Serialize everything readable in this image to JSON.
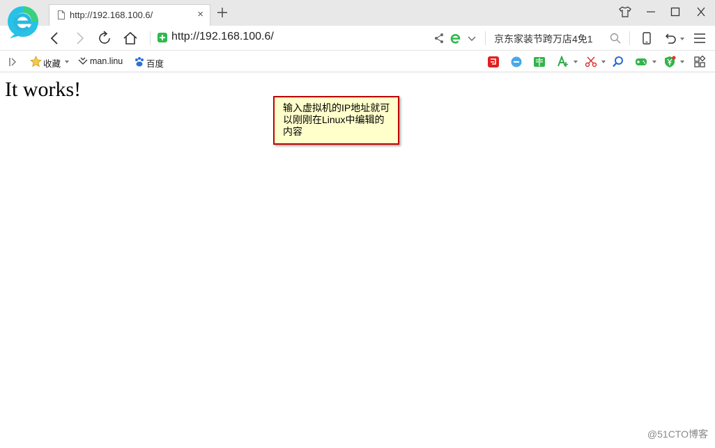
{
  "tab": {
    "title": "http://192.168.100.6/",
    "close": "×"
  },
  "toolbar": {
    "url": "http://192.168.100.6/",
    "search_text": "京东家装节跨万店4免1"
  },
  "bookmarks": {
    "favorites_label": "收藏",
    "items": [
      {
        "label": "man.linu",
        "icon": "linux-icon"
      },
      {
        "label": "百度",
        "icon": "baidu-paw-icon"
      }
    ]
  },
  "page": {
    "heading": "It works!"
  },
  "annotation": {
    "text": "输入虚拟机的IP地址就可以刚刚在Linux中编辑的内容"
  },
  "watermark": "@51CTO博客",
  "colors": {
    "secure_green": "#2fb84c",
    "note_fill": "#ffffcc",
    "note_border": "#c00000"
  }
}
